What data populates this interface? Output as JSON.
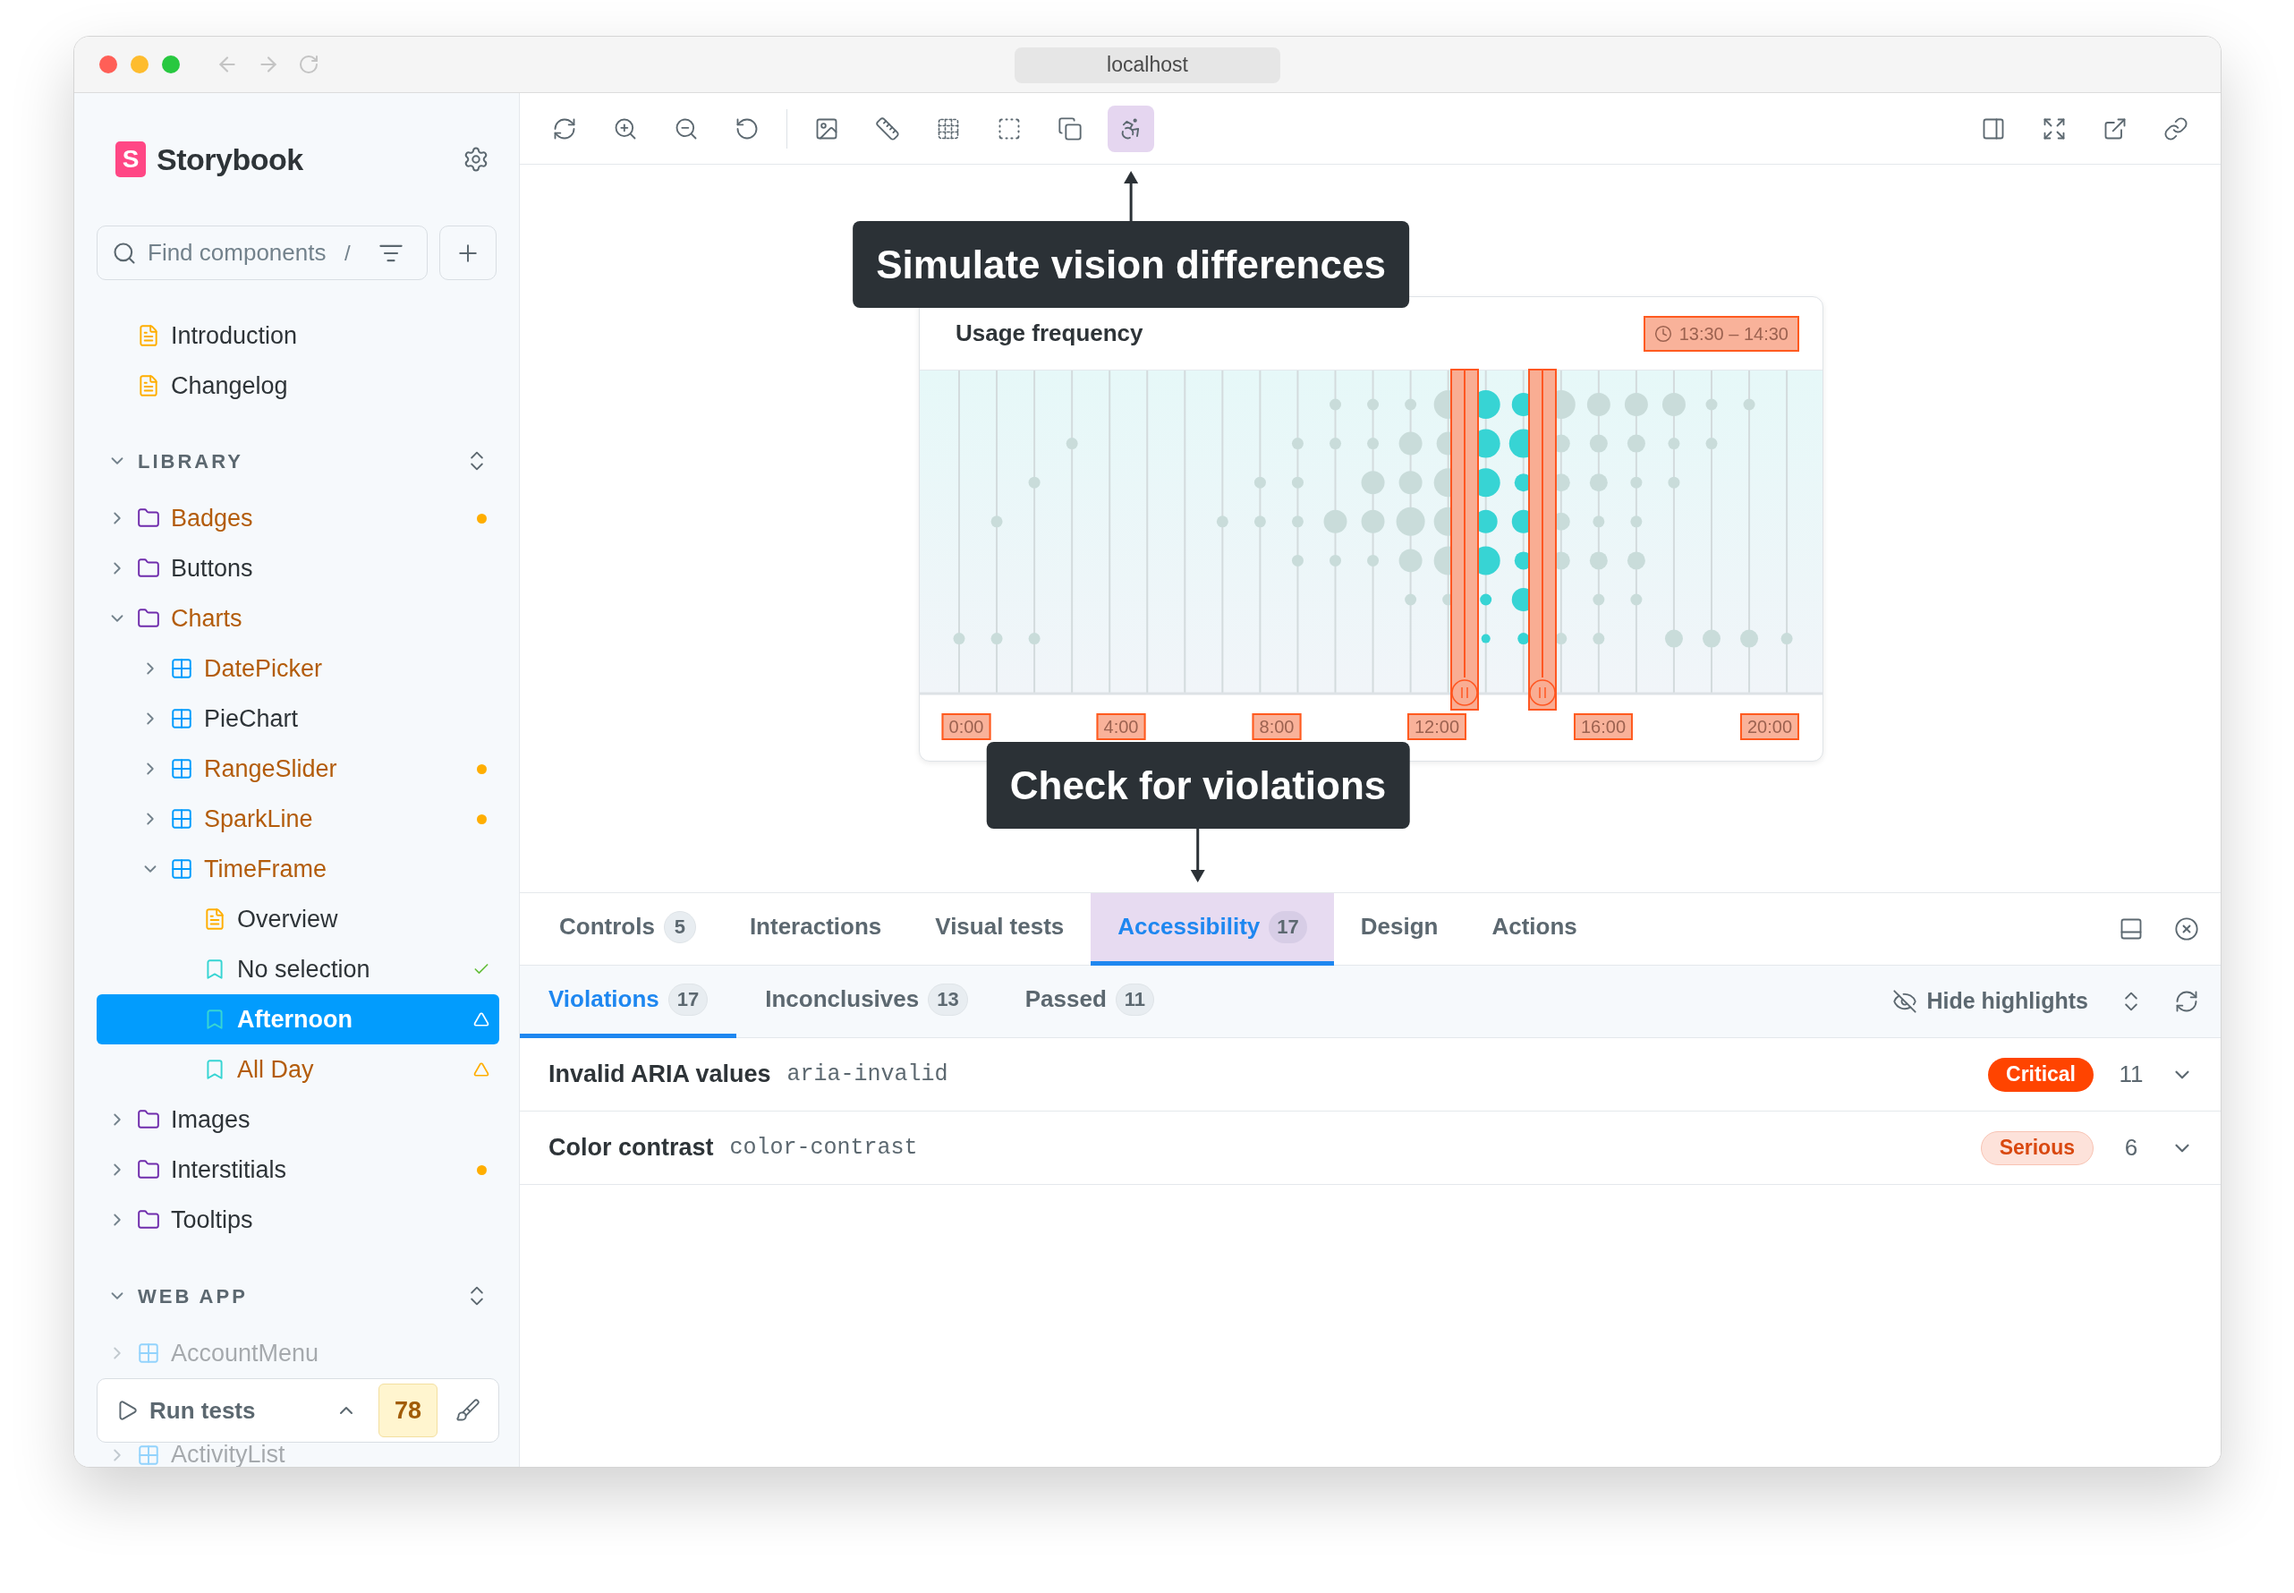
{
  "window": {
    "url": "localhost"
  },
  "sidebar": {
    "brand": {
      "logo_letter": "S",
      "name": "Storybook"
    },
    "search": {
      "placeholder": "Find components",
      "shortcut": "/"
    },
    "top_items": [
      {
        "kind": "doc",
        "label": "Introduction",
        "selected": false,
        "warning": false
      },
      {
        "kind": "doc",
        "label": "Changelog",
        "selected": false,
        "warning": false
      }
    ],
    "sections": [
      {
        "title": "LIBRARY",
        "faded": false,
        "items": [
          {
            "kind": "folder",
            "label": "Badges",
            "expanded": false,
            "selected": false,
            "warning": true,
            "status": {
              "kind": "dot"
            }
          },
          {
            "kind": "folder",
            "label": "Buttons",
            "expanded": false,
            "selected": false,
            "warning": false
          },
          {
            "kind": "folder",
            "label": "Charts",
            "expanded": true,
            "selected": false,
            "warning": true,
            "children": [
              {
                "kind": "component",
                "label": "DatePicker",
                "expanded": false,
                "selected": false,
                "warning": true
              },
              {
                "kind": "component",
                "label": "PieChart",
                "expanded": false,
                "selected": false,
                "warning": false
              },
              {
                "kind": "component",
                "label": "RangeSlider",
                "expanded": false,
                "selected": false,
                "warning": true,
                "status": {
                  "kind": "dot"
                }
              },
              {
                "kind": "component",
                "label": "SparkLine",
                "expanded": false,
                "selected": false,
                "warning": true,
                "status": {
                  "kind": "dot"
                }
              },
              {
                "kind": "component",
                "label": "TimeFrame",
                "expanded": true,
                "selected": false,
                "warning": true,
                "children": [
                  {
                    "kind": "doc",
                    "label": "Overview",
                    "selected": false,
                    "warning": false
                  },
                  {
                    "kind": "story",
                    "label": "No selection",
                    "selected": false,
                    "warning": false,
                    "status": {
                      "kind": "check"
                    }
                  },
                  {
                    "kind": "story",
                    "label": "Afternoon",
                    "selected": true,
                    "status": {
                      "kind": "triangle"
                    }
                  },
                  {
                    "kind": "story",
                    "label": "All Day",
                    "selected": false,
                    "warning": true,
                    "status": {
                      "kind": "triangle"
                    }
                  }
                ]
              }
            ]
          },
          {
            "kind": "folder",
            "label": "Images",
            "expanded": false,
            "selected": false,
            "warning": false
          },
          {
            "kind": "folder",
            "label": "Interstitials",
            "expanded": false,
            "selected": false,
            "warning": false,
            "status": {
              "kind": "dot"
            }
          },
          {
            "kind": "folder",
            "label": "Tooltips",
            "expanded": false,
            "selected": false,
            "warning": false
          }
        ]
      },
      {
        "title": "WEB APP",
        "faded": true,
        "items": [
          {
            "kind": "component",
            "label": "AccountMenu",
            "expanded": false,
            "selected": false,
            "warning": false
          }
        ]
      }
    ],
    "run_tests": {
      "label": "Run tests",
      "count": "78"
    },
    "after_footer": [
      {
        "kind": "component",
        "label": "ActivityList",
        "expanded": false,
        "selected": false,
        "warning": false
      }
    ]
  },
  "toolbar": {
    "groups": [
      {
        "tools": [
          {
            "kind": "remount",
            "selected": false
          },
          {
            "kind": "zoom-in",
            "selected": false
          },
          {
            "kind": "zoom-out",
            "selected": false
          },
          {
            "kind": "reset-zoom",
            "selected": false
          }
        ]
      },
      {
        "tools": [
          {
            "kind": "backgrounds",
            "selected": false
          },
          {
            "kind": "measure",
            "selected": false
          },
          {
            "kind": "grid",
            "selected": false
          },
          {
            "kind": "outline",
            "selected": false
          },
          {
            "kind": "viewport",
            "selected": false
          },
          {
            "kind": "vision",
            "selected": true
          }
        ]
      }
    ],
    "right_tools": [
      {
        "kind": "panel"
      },
      {
        "kind": "fullscreen"
      },
      {
        "kind": "open-new"
      },
      {
        "kind": "copy-link"
      }
    ]
  },
  "canvas": {
    "tooltips": [
      {
        "kind": "up",
        "text": "Simulate vision differences"
      },
      {
        "kind": "down",
        "text": "Check for violations"
      }
    ],
    "chart": {
      "title": "Usage frequency",
      "range": {
        "text": "13:30 – 14:30",
        "highlighted": true
      },
      "selection_highlighted": true,
      "ticks": [
        {
          "label": "0:00",
          "highlighted": true
        },
        {
          "label": "4:00",
          "highlighted": true
        },
        {
          "label": "8:00",
          "highlighted": true
        },
        {
          "label": "12:00",
          "highlighted": true
        },
        {
          "label": "16:00",
          "highlighted": true
        },
        {
          "label": "20:00",
          "highlighted": true
        }
      ]
    }
  },
  "addon_panel": {
    "tabs": [
      {
        "label": "Controls",
        "count": "5",
        "selected": false
      },
      {
        "label": "Interactions",
        "selected": false
      },
      {
        "label": "Visual tests",
        "selected": false
      },
      {
        "label": "Accessibility",
        "count": "17",
        "selected": true
      },
      {
        "label": "Design",
        "selected": false
      },
      {
        "label": "Actions",
        "selected": false
      }
    ],
    "subtabs": [
      {
        "label": "Violations",
        "count": "17",
        "selected": true
      },
      {
        "label": "Inconclusives",
        "count": "13",
        "selected": false
      },
      {
        "label": "Passed",
        "count": "11",
        "selected": false
      }
    ],
    "hide_highlights": "Hide highlights",
    "violations": [
      {
        "title": "Invalid ARIA values",
        "rule": "aria-invalid",
        "kind": "critical",
        "severity_label": "Critical",
        "count": "11",
        "expanded": false
      },
      {
        "title": "Color contrast",
        "rule": "color-contrast",
        "kind": "serious",
        "severity_label": "Serious",
        "count": "6",
        "expanded": false
      }
    ]
  }
}
